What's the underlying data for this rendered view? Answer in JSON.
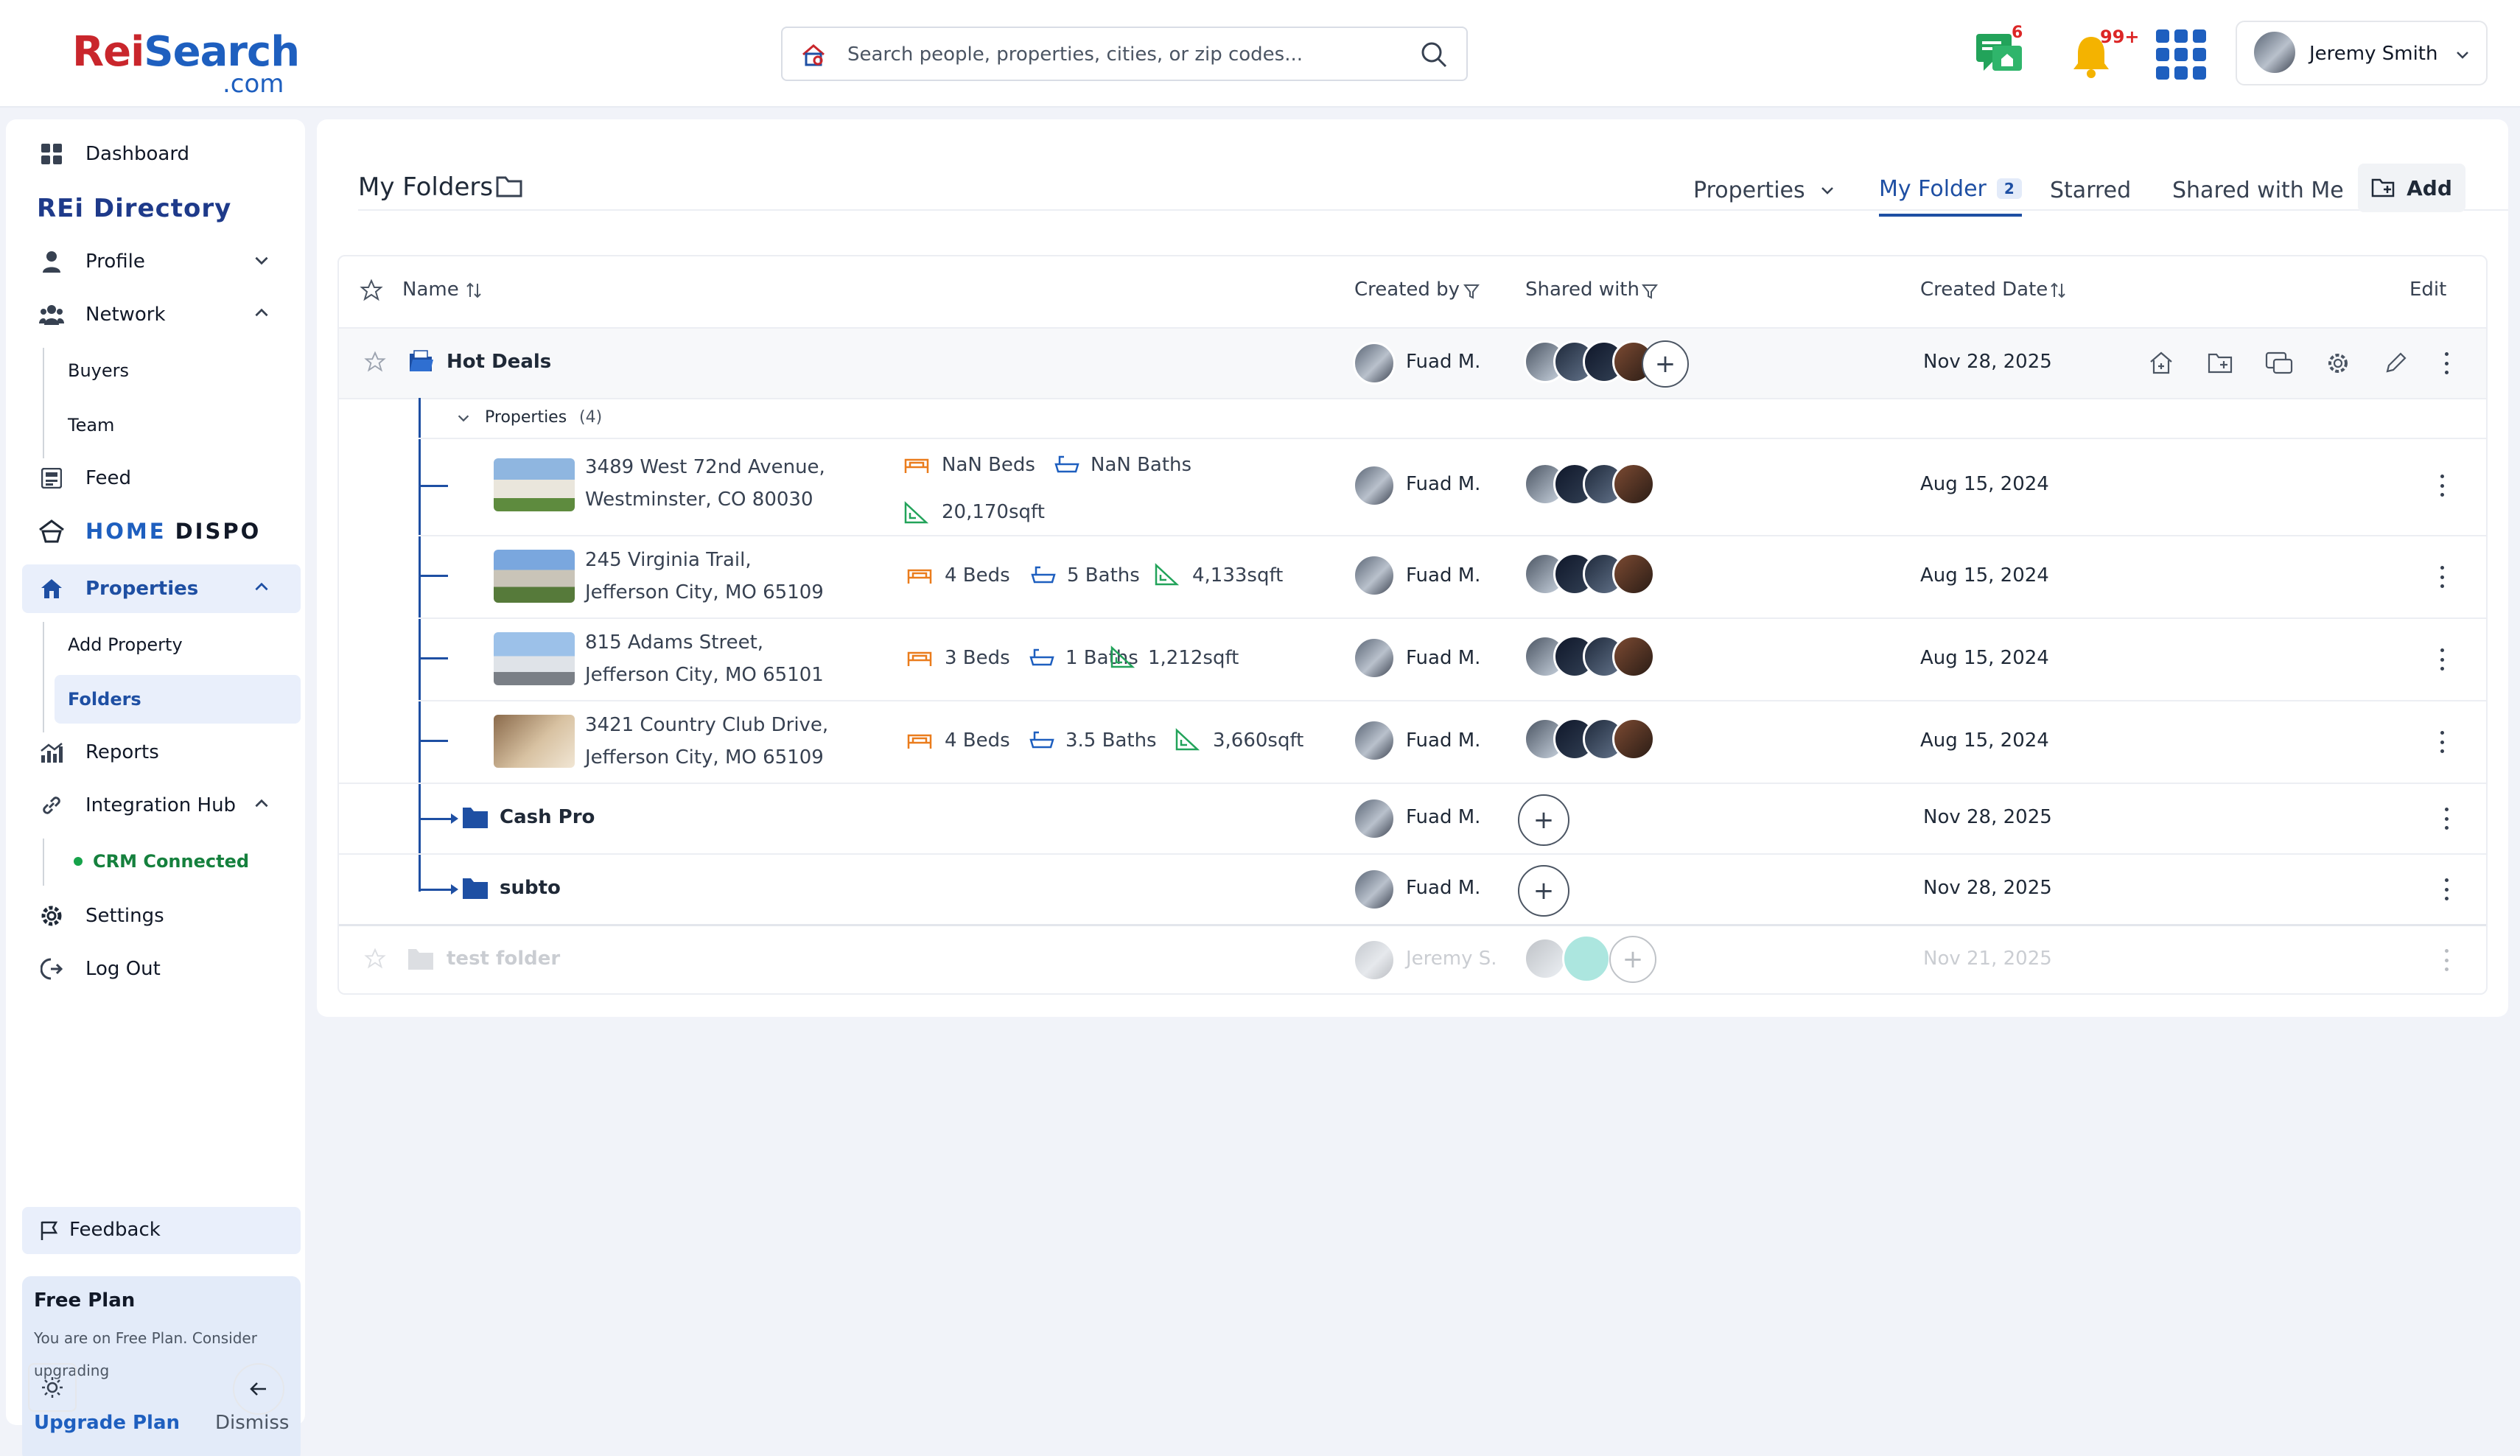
{
  "brand": {
    "name_part1": "Rei",
    "name_part2": "Search",
    "domain": ".com"
  },
  "search": {
    "placeholder": "Search people, properties, cities, or zip codes..."
  },
  "header": {
    "messages_count": "6",
    "notifications_count": "99+",
    "user_name": "Jeremy Smith"
  },
  "sidebar": {
    "items": [
      {
        "label": "Dashboard"
      },
      {
        "label": "REi Directory"
      },
      {
        "label": "Profile"
      },
      {
        "label": "Network"
      },
      {
        "label": "Buyers"
      },
      {
        "label": "Team"
      },
      {
        "label": "Feed"
      },
      {
        "label_a": "HOME",
        "label_b": "DISPO"
      },
      {
        "label": "Properties"
      },
      {
        "label": "Add Property"
      },
      {
        "label": "Folders"
      },
      {
        "label": "Reports"
      },
      {
        "label": "Integration Hub"
      },
      {
        "label": "CRM Connected"
      },
      {
        "label": "Settings"
      },
      {
        "label": "Log Out"
      }
    ],
    "feedback": "Feedback",
    "plan": {
      "title": "Free Plan",
      "description": "You are on Free Plan. Consider upgrading",
      "upgrade": "Upgrade Plan",
      "dismiss": "Dismiss"
    }
  },
  "page": {
    "title": "My Folders",
    "tabs": {
      "properties": "Properties",
      "my_folder": "My Folder",
      "my_folder_count": "2",
      "starred": "Starred",
      "shared": "Shared with Me",
      "add": "Add"
    }
  },
  "table": {
    "headers": {
      "name": "Name",
      "created_by": "Created by",
      "shared_with": "Shared with",
      "created_date": "Created Date",
      "edit": "Edit"
    },
    "folder": {
      "name": "Hot Deals",
      "created_by": "Fuad M.",
      "date": "Nov 28, 2025"
    },
    "properties_group": {
      "label": "Properties",
      "count": "(4)"
    },
    "properties": [
      {
        "addr1": "3489 West 72nd Avenue,",
        "addr2": "Westminster, CO 80030",
        "beds": "NaN Beds",
        "baths": "NaN Baths",
        "sqft": "20,170sqft",
        "created_by": "Fuad M.",
        "date": "Aug 15, 2024"
      },
      {
        "addr1": "245 Virginia Trail,",
        "addr2": "Jefferson City, MO 65109",
        "beds": "4 Beds",
        "baths": "5 Baths",
        "sqft": "4,133sqft",
        "created_by": "Fuad M.",
        "date": "Aug 15, 2024"
      },
      {
        "addr1": "815 Adams Street,",
        "addr2": "Jefferson City, MO 65101",
        "beds": "3 Beds",
        "baths": "1 Baths",
        "sqft": "1,212sqft",
        "created_by": "Fuad M.",
        "date": "Aug 15, 2024"
      },
      {
        "addr1": "3421 Country Club Drive,",
        "addr2": "Jefferson City, MO 65109",
        "beds": "4 Beds",
        "baths": "3.5 Baths",
        "sqft": "3,660sqft",
        "created_by": "Fuad M.",
        "date": "Aug 15, 2024"
      }
    ],
    "subfolders": [
      {
        "name": "Cash Pro",
        "created_by": "Fuad M.",
        "date": "Nov 28, 2025"
      },
      {
        "name": "subto",
        "created_by": "Fuad M.",
        "date": "Nov 28, 2025"
      }
    ],
    "dimmed_folder": {
      "name": "test folder",
      "created_by": "Jeremy S.",
      "date": "Nov 21, 2025"
    }
  },
  "colors": {
    "primary": "#1e4fa3",
    "accent_orange": "#ea7c1c",
    "accent_green": "#22a35a",
    "brand_red": "#c9262c"
  }
}
